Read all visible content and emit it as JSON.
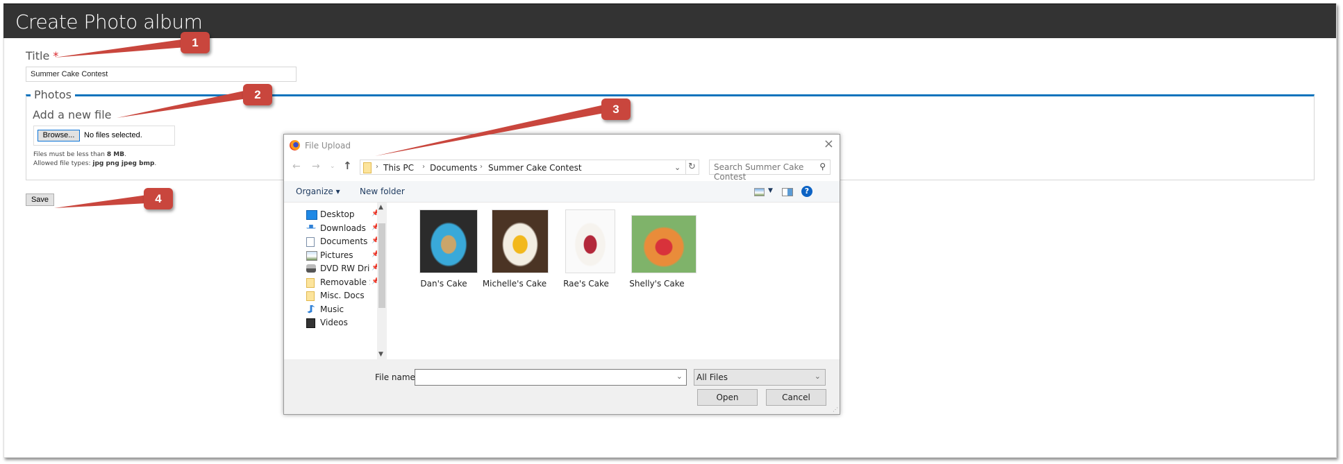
{
  "page": {
    "title": "Create Photo album",
    "title_field": {
      "label": "Title",
      "required_mark": "*",
      "value": "Summer Cake Contest"
    },
    "photos": {
      "legend": "Photos",
      "add_label": "Add a new file",
      "browse_label": "Browse...",
      "no_files": "No files selected.",
      "hint_size_prefix": "Files must be less than ",
      "hint_size_value": "8 MB",
      "hint_size_suffix": ".",
      "hint_types_prefix": "Allowed file types: ",
      "hint_types_value": "jpg png jpeg bmp",
      "hint_types_suffix": "."
    },
    "save_label": "Save"
  },
  "dialog": {
    "title": "File Upload",
    "close_glyph": "×",
    "back_glyph": "←",
    "forward_glyph": "→",
    "recent_glyph": "⌄",
    "up_glyph": "↑",
    "breadcrumb": [
      "This PC",
      "Documents",
      "Summer Cake Contest"
    ],
    "breadcrumb_sep": "›",
    "refresh_glyph": "↻",
    "search_placeholder": "Search Summer Cake Contest",
    "search_glyph": "⚲",
    "toolbar": {
      "organize": "Organize ▾",
      "new_folder": "New folder",
      "help": "?"
    },
    "nav_items": [
      {
        "label": "Desktop",
        "icon": "desktop-icon",
        "pinned": true
      },
      {
        "label": "Downloads",
        "icon": "downloads-icon",
        "pinned": true
      },
      {
        "label": "Documents",
        "icon": "documents-icon",
        "pinned": true
      },
      {
        "label": "Pictures",
        "icon": "pictures-icon",
        "pinned": true
      },
      {
        "label": "DVD RW Drive",
        "icon": "dvd-drive-icon",
        "pinned": true
      },
      {
        "label": "Removable Storage",
        "icon": "folder-icon",
        "pinned": true
      },
      {
        "label": "Misc. Docs",
        "icon": "folder-icon",
        "pinned": false
      },
      {
        "label": "Music",
        "icon": "music-icon",
        "pinned": false
      },
      {
        "label": "Videos",
        "icon": "videos-icon",
        "pinned": false
      }
    ],
    "files": [
      {
        "name": "Dan's Cake",
        "colors": [
          "#2b2b2b",
          "#39a9d9",
          "#caa56a"
        ]
      },
      {
        "name": "Michelle's Cake",
        "colors": [
          "#4b3424",
          "#f3eee2",
          "#f2b81c"
        ]
      },
      {
        "name": "Rae's Cake",
        "colors": [
          "#fafafa",
          "#f6f3ee",
          "#b3283a"
        ]
      },
      {
        "name": "Shelly's Cake",
        "colors": [
          "#7fb36a",
          "#e98c3a",
          "#d8323b"
        ]
      }
    ],
    "file_name_label": "File name:",
    "file_name_value": "",
    "filter_value": "All Files",
    "open_label": "Open",
    "cancel_label": "Cancel",
    "dropdown_glyph": "⌄"
  },
  "callouts": [
    "1",
    "2",
    "3",
    "4"
  ],
  "colors": {
    "header_bg": "#333333",
    "accent_blue": "#0a73bc",
    "callout_red": "#c9463d",
    "required_red": "#d9262c"
  }
}
